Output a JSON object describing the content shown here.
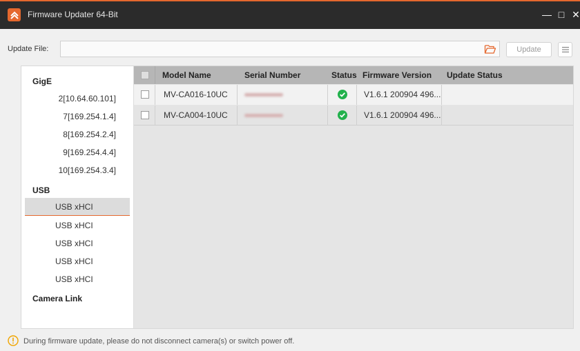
{
  "window": {
    "title": "Firmware Updater 64-Bit",
    "minimize_glyph": "—",
    "maximize_glyph": "□",
    "close_glyph": "✕"
  },
  "toolbar": {
    "update_file_label": "Update File:",
    "update_file_value": "",
    "update_button": "Update",
    "folder_icon": "folder-open-icon",
    "menu_icon": "menu-icon"
  },
  "sidebar": {
    "gige_label": "GigE",
    "gige_items": [
      "2[10.64.60.101]",
      "7[169.254.1.4]",
      "8[169.254.2.4]",
      "9[169.254.4.4]",
      "10[169.254.3.4]"
    ],
    "usb_label": "USB",
    "usb_items": [
      "USB xHCI",
      "USB xHCI",
      "USB xHCI",
      "USB xHCI",
      "USB xHCI"
    ],
    "usb_selected_index": 0,
    "cameralink_label": "Camera Link"
  },
  "table": {
    "columns": [
      "",
      "Model Name",
      "Serial Number",
      "Status",
      "Firmware Version",
      "Update Status"
    ],
    "rows": [
      {
        "checked": false,
        "model": "MV-CA016-10UC",
        "serial": "",
        "status": "ok",
        "firmware": "V1.6.1 200904 496...",
        "update_status": ""
      },
      {
        "checked": false,
        "model": "MV-CA004-10UC",
        "serial": "",
        "status": "ok",
        "firmware": "V1.6.1 200904 496...",
        "update_status": ""
      }
    ]
  },
  "footer": {
    "warning_text": "During firmware update, please do not disconnect camera(s) or switch power off."
  },
  "colors": {
    "accent": "#e5682e",
    "titlebar": "#2b2b2b",
    "status_ok": "#22b14c",
    "header_bg": "#b6b6b6"
  }
}
